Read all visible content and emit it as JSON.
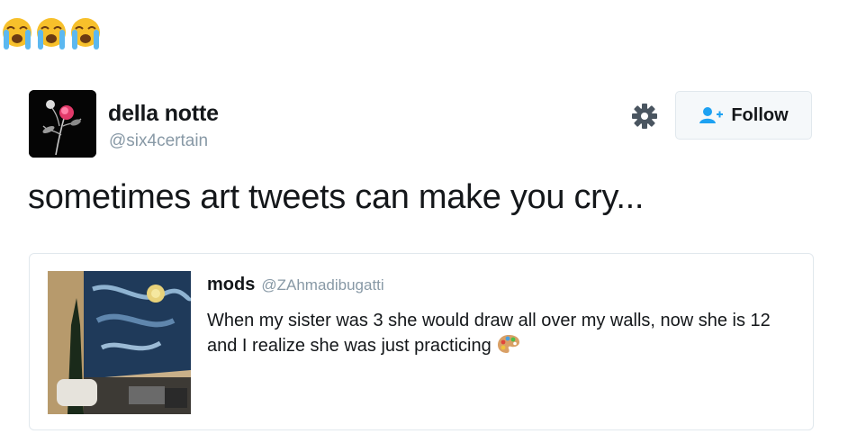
{
  "reaction": {
    "emojis": [
      "loudly-crying-face",
      "loudly-crying-face",
      "loudly-crying-face"
    ]
  },
  "tweet": {
    "author": {
      "display_name": "della notte",
      "handle": "@six4certain"
    },
    "follow_label": "Follow",
    "text": "sometimes art tweets can make you cry..."
  },
  "quoted": {
    "author": {
      "display_name": "mods",
      "handle": "@ZAhmadibugatti"
    },
    "text": "When my sister was 3 she would draw all over my walls, now she is 12 and I realize she was just practicing",
    "trailing_emoji": "artist-palette"
  },
  "colors": {
    "text": "#14171a",
    "muted": "#8899a6",
    "border": "#e1e8ed",
    "accent": "#1da1f2"
  }
}
